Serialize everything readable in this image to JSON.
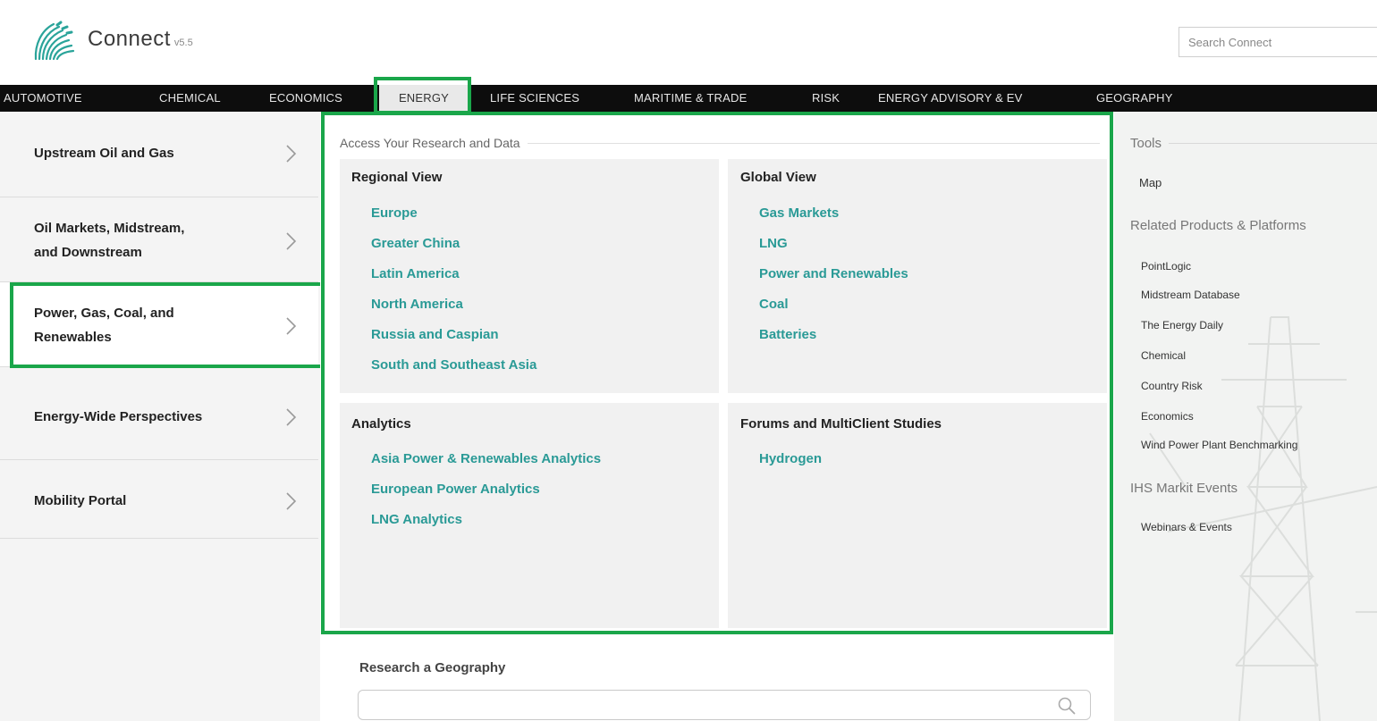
{
  "brand": {
    "name": "Connect",
    "version": "v5.5"
  },
  "search": {
    "placeholder": "Search Connect"
  },
  "nav": {
    "items": [
      "AUTOMOTIVE",
      "CHEMICAL",
      "ECONOMICS",
      "ENERGY",
      "LIFE SCIENCES",
      "MARITIME & TRADE",
      "RISK",
      "ENERGY ADVISORY & EV",
      "GEOGRAPHY"
    ],
    "active": "ENERGY"
  },
  "sidebar": {
    "items": [
      {
        "label_lines": [
          "Upstream Oil and Gas"
        ]
      },
      {
        "label_lines": [
          "Oil Markets, Midstream,",
          "and Downstream"
        ]
      },
      {
        "label_lines": [
          "Power, Gas, Coal, and",
          "Renewables"
        ]
      },
      {
        "label_lines": [
          "Energy-Wide Perspectives"
        ]
      },
      {
        "label_lines": [
          "Mobility Portal"
        ]
      }
    ],
    "active_index": 2
  },
  "main": {
    "heading": "Access Your Research and Data",
    "sections": [
      {
        "title": "Regional View",
        "links": [
          "Europe",
          "Greater China",
          "Latin America",
          "North America",
          "Russia and Caspian",
          "South and Southeast Asia"
        ]
      },
      {
        "title": "Global View",
        "links": [
          "Gas Markets",
          "LNG",
          "Power and Renewables",
          "Coal",
          "Batteries"
        ]
      },
      {
        "title": "Analytics",
        "links": [
          "Asia Power & Renewables Analytics",
          "European Power Analytics",
          "LNG Analytics"
        ]
      },
      {
        "title": "Forums and MultiClient Studies",
        "links": [
          "Hydrogen"
        ]
      }
    ],
    "geography_label": "Research a Geography"
  },
  "right": {
    "tools_heading": "Tools",
    "tools": [
      "Map"
    ],
    "related_heading": "Related Products & Platforms",
    "related": [
      "PointLogic",
      "Midstream Database",
      "The Energy Daily",
      "Chemical",
      "Country Risk",
      "Economics",
      "Wind Power Plant Benchmarking"
    ],
    "events_heading": "IHS Markit Events",
    "events": [
      "Webinars & Events"
    ]
  },
  "colors": {
    "accent_link": "#2a9a96",
    "highlight": "#1aa64a",
    "nav_bg": "#0d0d0d"
  },
  "icons": [
    "connect-logo-icon",
    "chevron-right-icon",
    "search-icon"
  ]
}
